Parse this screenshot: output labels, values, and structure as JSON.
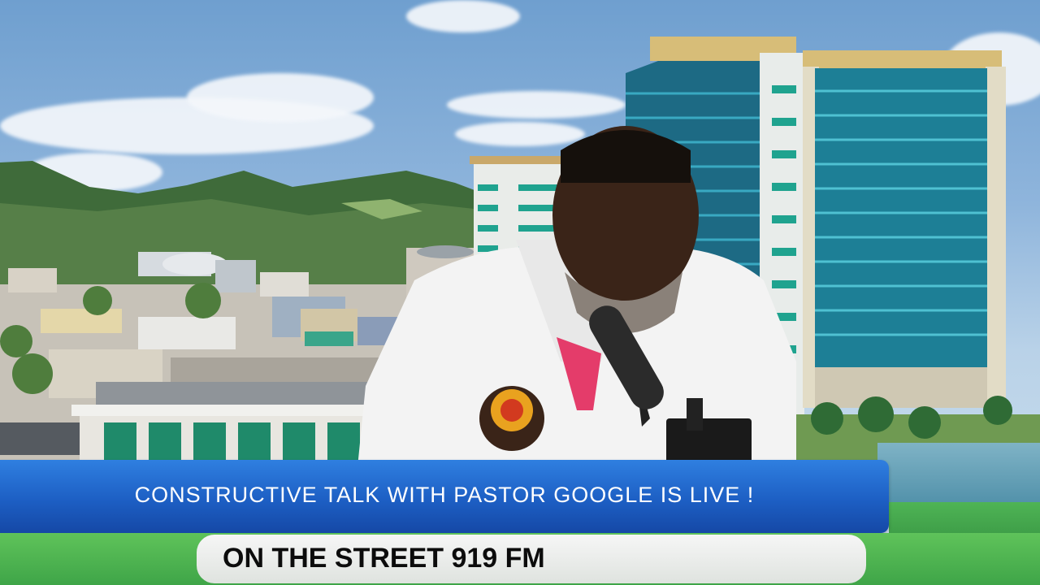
{
  "broadcast": {
    "headline": "CONSTRUCTIVE TALK WITH PASTOR GOOGLE IS LIVE !",
    "station": "ON THE STREET 919 FM"
  },
  "colors": {
    "banner_blue": "#1d5fc4",
    "ticker_green": "#4fb455",
    "ticker_bg": "#f0f0f0",
    "headline_text": "#ffffff",
    "station_text": "#0c0c0c"
  }
}
